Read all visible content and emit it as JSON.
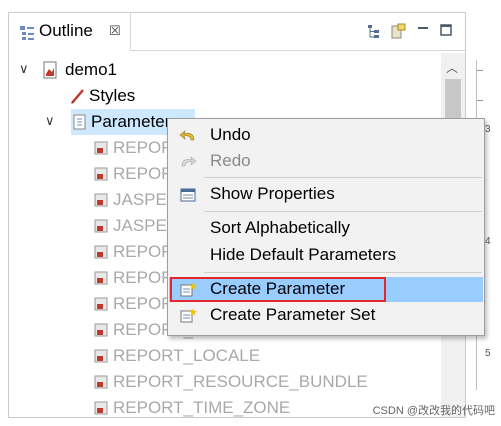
{
  "tab": {
    "label": "Outline",
    "close": "☒"
  },
  "tree": {
    "root": "demo1",
    "styles": "Styles",
    "parameters": "Parameters",
    "children": [
      "REPOR",
      "REPOR",
      "JASPER",
      "JASPER",
      "REPOR",
      "REPOR",
      "REPOR",
      "REPORT_SCRIPTLET",
      "REPORT_LOCALE",
      "REPORT_RESOURCE_BUNDLE",
      "REPORT_TIME_ZONE"
    ]
  },
  "menu": {
    "items": [
      {
        "label": "Undo"
      },
      {
        "label": "Redo"
      },
      {
        "label": "Show Properties"
      },
      {
        "label": "Sort Alphabetically"
      },
      {
        "label": "Hide Default Parameters"
      },
      {
        "label": "Create Parameter"
      },
      {
        "label": "Create Parameter Set"
      }
    ]
  },
  "ruler": {
    "marks": [
      "3",
      "4",
      "5"
    ]
  },
  "watermark": "CSDN @改改我的代码吧"
}
